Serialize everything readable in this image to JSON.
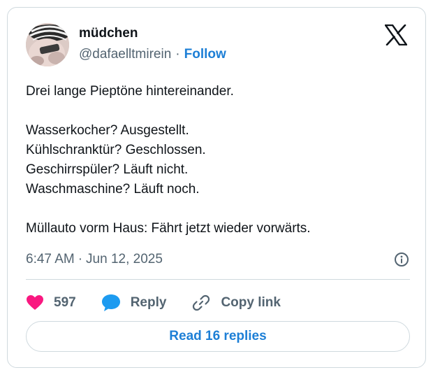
{
  "author": {
    "display_name": "müdchen",
    "handle": "@dafaelltmirein",
    "separator": "·",
    "follow_label": "Follow"
  },
  "brand": {
    "icon": "x-logo-icon"
  },
  "tweet": {
    "lines": [
      "Drei lange Pieptöne hintereinander.",
      "",
      "Wasserkocher? Ausgestellt.",
      "Kühlschranktür? Geschlossen.",
      "Geschirrspüler? Läuft nicht.",
      "Waschmaschine? Läuft noch.",
      "",
      "Müllauto vorm Haus: Fährt jetzt wieder vorwärts."
    ],
    "time": "6:47 AM",
    "separator": "·",
    "date": "Jun 12, 2025"
  },
  "actions": {
    "like_count": "597",
    "reply_label": "Reply",
    "copy_link_label": "Copy link"
  },
  "read_replies_label": "Read 16 replies",
  "colors": {
    "accent": "#1d7fd6",
    "like": "#f91880",
    "reply": "#1d9bf0",
    "muted": "#536471",
    "border": "#cfd9de"
  }
}
